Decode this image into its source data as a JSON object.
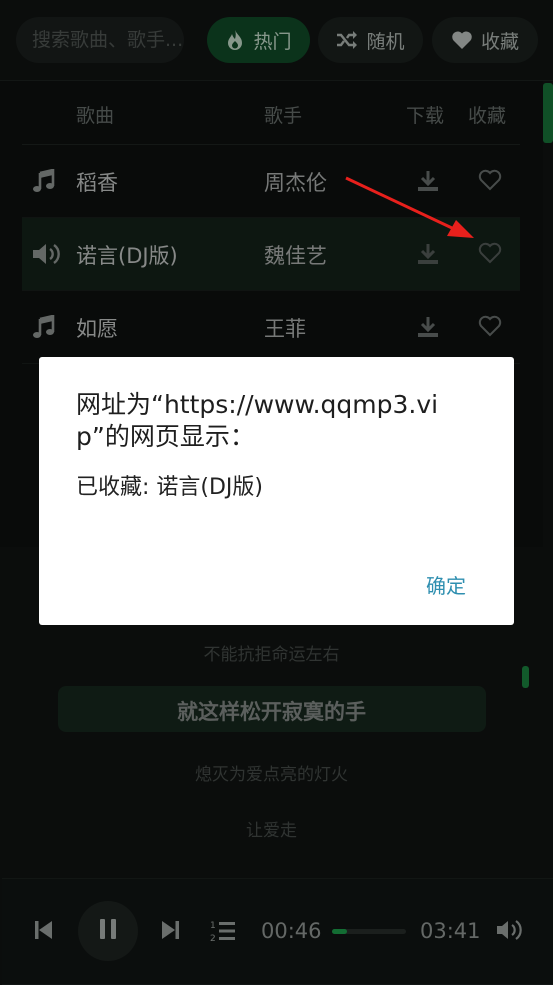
{
  "search": {
    "placeholder": "搜索歌曲、歌手..."
  },
  "tabs": [
    {
      "label": "热门",
      "icon": "flame-icon"
    },
    {
      "label": "随机",
      "icon": "shuffle-icon"
    },
    {
      "label": "收藏",
      "icon": "heart-icon"
    }
  ],
  "table": {
    "headers": {
      "song": "歌曲",
      "artist": "歌手",
      "download": "下载",
      "favorite": "收藏"
    },
    "rows": [
      {
        "song": "稻香",
        "artist": "周杰伦",
        "icon": "music-note-icon",
        "active": false
      },
      {
        "song": "诺言(DJ版)",
        "artist": "魏佳艺",
        "icon": "speaker-icon",
        "active": true
      },
      {
        "song": "如愿",
        "artist": "王菲",
        "icon": "music-note-icon",
        "active": false
      }
    ]
  },
  "lyrics": {
    "lines": [
      "不能抗拒命运左右",
      "就这样松开寂寞的手",
      "熄灭为爱点亮的灯火",
      "让爱走"
    ],
    "current_index": 1
  },
  "player": {
    "current_time": "00:46",
    "total_time": "03:41",
    "progress": 0.208
  },
  "dialog": {
    "title": "网址为“https://www.qqmp3.vip”的网页显示：",
    "message": "已收藏: 诺言(DJ版)",
    "ok_label": "确定"
  },
  "colors": {
    "accent": "#1ea84f",
    "hot_tab_bg": "#114f2a",
    "dialog_button": "#2f8fb0",
    "arrow": "#e8201c"
  }
}
